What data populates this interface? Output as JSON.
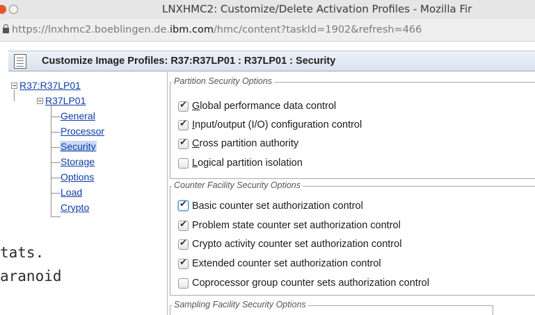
{
  "window": {
    "title": "LNXHMC2: Customize/Delete Activation Profiles - Mozilla Fir"
  },
  "urlbar": {
    "url_prefix": "https://lnxhmc2.boeblingen.de.",
    "url_domain": "ibm.com",
    "url_suffix": "/hmc/content?taskId=1902&refresh=466"
  },
  "background_terminal": {
    "line1": "tats.",
    "line2": "aranoid"
  },
  "header": {
    "title": "Customize Image Profiles: R37:R37LP01 : R37LP01 : Security"
  },
  "tree": {
    "root": "R37:R37LP01",
    "child": "R37LP01",
    "items": [
      "General",
      "Processor",
      "Security",
      "Storage",
      "Options",
      "Load",
      "Crypto"
    ],
    "selected": "Security"
  },
  "partition_security": {
    "legend": "Partition Security Options",
    "options": [
      {
        "first": "G",
        "rest": "lobal performance data control",
        "checked": true
      },
      {
        "first": "I",
        "rest": "nput/output (I/O) configuration control",
        "checked": true
      },
      {
        "first": "C",
        "rest": "ross partition authority",
        "checked": true
      },
      {
        "first": "L",
        "rest": "ogical partition isolation",
        "checked": false
      }
    ]
  },
  "counter_facility_security": {
    "legend": "Counter Facility Security Options",
    "options": [
      {
        "label": "Basic counter set authorization control",
        "checked": true
      },
      {
        "label": "Problem state counter set authorization control",
        "checked": true
      },
      {
        "label": "Crypto activity counter set authorization control",
        "checked": true
      },
      {
        "label": "Extended counter set authorization control",
        "checked": true
      },
      {
        "label": "Coprocessor group counter sets authorization control",
        "checked": false
      }
    ]
  },
  "sampling_facility_security": {
    "legend": "Sampling Facility Security Options"
  },
  "colors": {
    "link": "#0b3da8",
    "selection": "#c8daf7",
    "header_gradient_top": "#eef2f8",
    "header_gradient_bottom": "#d9e1ec"
  }
}
